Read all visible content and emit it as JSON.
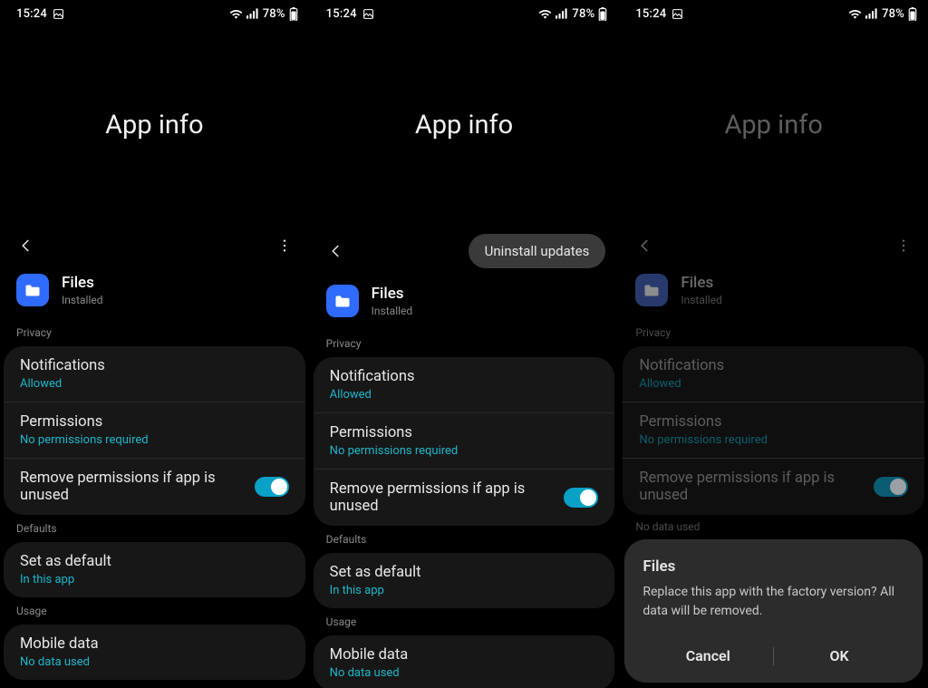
{
  "status": {
    "time": "15:24",
    "battery": "78%"
  },
  "title": "App info",
  "menu": {
    "uninstall_updates": "Uninstall updates"
  },
  "app": {
    "name": "Files",
    "status": "Installed"
  },
  "sections": {
    "privacy": "Privacy",
    "defaults": "Defaults",
    "usage": "Usage"
  },
  "privacy": {
    "notifications": {
      "label": "Notifications",
      "value": "Allowed"
    },
    "permissions": {
      "label": "Permissions",
      "value": "No permissions required"
    },
    "remove": {
      "label": "Remove permissions if app is unused",
      "on": true
    }
  },
  "defaults": {
    "set_default": {
      "label": "Set as default",
      "value": "In this app"
    }
  },
  "usage": {
    "mobile_data": {
      "label": "Mobile data",
      "value": "No data used"
    }
  },
  "dialog": {
    "title": "Files",
    "message": "Replace this app with the factory version? All data will be removed.",
    "cancel": "Cancel",
    "ok": "OK"
  }
}
